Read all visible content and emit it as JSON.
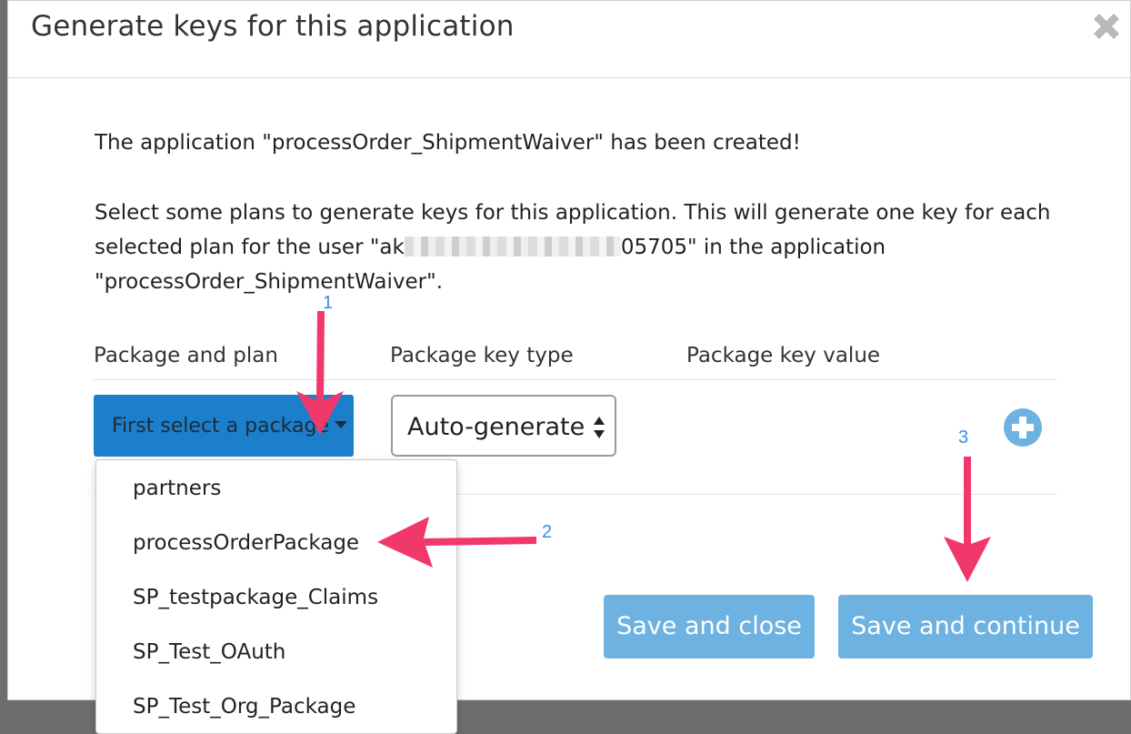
{
  "dialog": {
    "title": "Generate keys for this application",
    "intro": "The application \"processOrder_ShipmentWaiver\" has been created!",
    "desc_line1": "Select some plans to generate keys for this application. This will generate one key for each",
    "desc_line2_a": "selected plan for the user \"ak",
    "desc_line2_b": "05705\" in the application",
    "desc_line3": "\"processOrder_ShipmentWaiver\"."
  },
  "table": {
    "col_package_plan": "Package and plan",
    "col_key_type": "Package key type",
    "col_key_value": "Package key value"
  },
  "package_button": {
    "label": "First select a package"
  },
  "key_type_select": {
    "value": "Auto-generate"
  },
  "dropdown": {
    "items": [
      "partners",
      "processOrderPackage",
      "SP_testpackage_Claims",
      "SP_Test_OAuth",
      "SP_Test_Org_Package"
    ]
  },
  "buttons": {
    "save_close": "Save and close",
    "save_continue": "Save and continue"
  },
  "annotations": [
    "1",
    "2",
    "3"
  ],
  "colors": {
    "primary": "#1b7fcb",
    "button_light": "#6db2e0",
    "arrow": "#f0386b",
    "annotation": "#3a8de8"
  }
}
